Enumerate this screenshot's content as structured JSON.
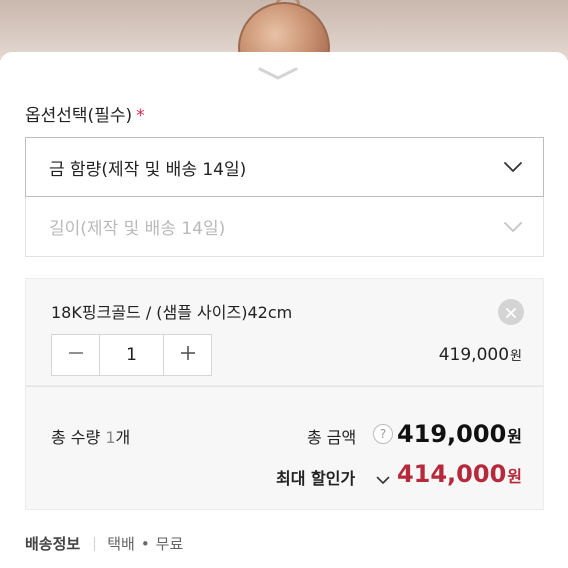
{
  "option_section": {
    "title": "옵션선택(필수)",
    "required_mark": "*"
  },
  "selects": [
    {
      "label": "금 함량(제작 및 배송 14일)",
      "state": "enabled"
    },
    {
      "label": "길이(제작 및 배송 14일)",
      "state": "disabled"
    }
  ],
  "selected_item": {
    "name": "18K핑크골드 / (샘플 사이즈)42cm",
    "quantity": "1",
    "price": "419,000",
    "currency": "원"
  },
  "summary": {
    "qty_label": "총 수량",
    "qty_value": "1",
    "qty_unit": "개",
    "total_label": "총 금액",
    "help_symbol": "?",
    "total_price": "419,000",
    "discount_label": "최대 할인가",
    "discount_price": "414,000",
    "currency": "원"
  },
  "shipping": {
    "label": "배송정보",
    "method": "택배",
    "dot": "•",
    "fee": "무료"
  },
  "icons": {
    "handle": "chevron-down-icon",
    "select_arrow": "chevron-down-icon",
    "remove": "close-icon",
    "minus": "minus-icon",
    "plus": "plus-icon",
    "help": "question-icon"
  },
  "colors": {
    "required": "#e0284b",
    "discount": "#b5293b",
    "panel_bg": "#f7f7f7"
  }
}
